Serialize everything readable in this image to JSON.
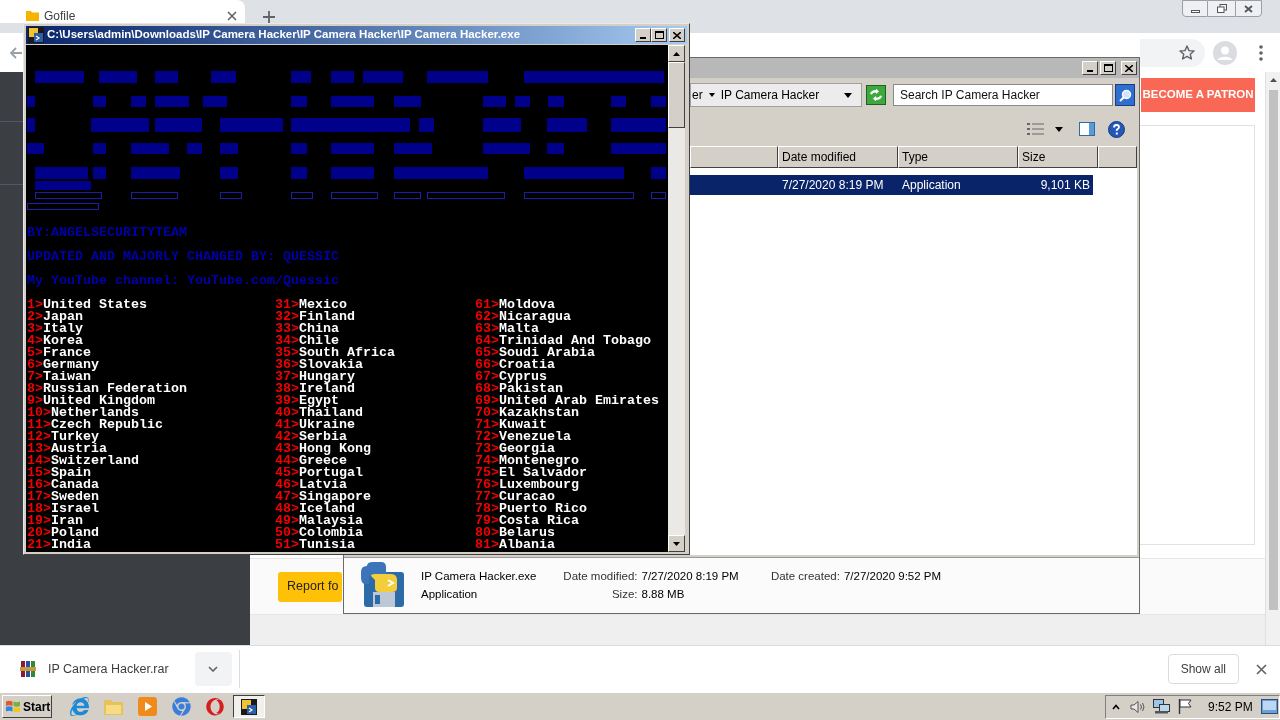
{
  "browser": {
    "tab": {
      "title": "Gofile"
    },
    "patron_button": "BECOME A PATRON",
    "report_button": "Report fo"
  },
  "download_bar": {
    "file_name": "IP Camera Hacker.rar",
    "show_all": "Show all"
  },
  "explorer": {
    "breadcrumb": [
      "er",
      "IP Camera Hacker"
    ],
    "search": {
      "placeholder": "Search IP Camera Hacker"
    },
    "columns": [
      "Date modified",
      "Type",
      "Size"
    ],
    "rows": [
      {
        "selected": true,
        "cells": [
          "7/27/2020 8:19 PM",
          "Application",
          "9,101 KB"
        ]
      }
    ],
    "details": {
      "name": "IP Camera Hacker.exe",
      "type": "Application",
      "field_groups": [
        [
          {
            "label": "Date modified:",
            "value": "7/27/2020 8:19 PM"
          },
          {
            "label": "Size:",
            "value": "8.88 MB"
          }
        ],
        [
          {
            "label": "Date created:",
            "value": "7/27/2020 9:52 PM"
          }
        ]
      ]
    }
  },
  "console": {
    "title": "C:\\Users\\admin\\Downloads\\IP Camera Hacker\\IP Camera Hacker\\IP Camera Hacker.exe",
    "lines": [
      "BY:ANGELSECURITYTEAM",
      "UPDATED AND MAJORLY CHANGED BY: QUESSIC",
      "My YouTube channel: YouTube.com/Quessic"
    ],
    "menu_columns": [
      [
        {
          "num": "1>",
          "name": "United States"
        },
        {
          "num": "2>",
          "name": "Japan"
        },
        {
          "num": "3>",
          "name": "Italy"
        },
        {
          "num": "4>",
          "name": "Korea"
        },
        {
          "num": "5>",
          "name": "France"
        },
        {
          "num": "6>",
          "name": "Germany"
        },
        {
          "num": "7>",
          "name": "Taiwan"
        },
        {
          "num": "8>",
          "name": "Russian Federation"
        },
        {
          "num": "9>",
          "name": "United Kingdom"
        },
        {
          "num": "10>",
          "name": "Netherlands"
        },
        {
          "num": "11>",
          "name": "Czech Republic"
        },
        {
          "num": "12>",
          "name": "Turkey"
        },
        {
          "num": "13>",
          "name": "Austria"
        },
        {
          "num": "14>",
          "name": "Switzerland"
        },
        {
          "num": "15>",
          "name": "Spain"
        },
        {
          "num": "16>",
          "name": "Canada"
        },
        {
          "num": "17>",
          "name": "Sweden"
        },
        {
          "num": "18>",
          "name": "Israel"
        },
        {
          "num": "19>",
          "name": "Iran"
        },
        {
          "num": "20>",
          "name": "Poland"
        },
        {
          "num": "21>",
          "name": "India"
        }
      ],
      [
        {
          "num": "31>",
          "name": "Mexico"
        },
        {
          "num": "32>",
          "name": "Finland"
        },
        {
          "num": "33>",
          "name": "China"
        },
        {
          "num": "34>",
          "name": "Chile"
        },
        {
          "num": "35>",
          "name": "South Africa"
        },
        {
          "num": "36>",
          "name": "Slovakia"
        },
        {
          "num": "37>",
          "name": "Hungary"
        },
        {
          "num": "38>",
          "name": "Ireland"
        },
        {
          "num": "39>",
          "name": "Egypt"
        },
        {
          "num": "40>",
          "name": "Thailand"
        },
        {
          "num": "41>",
          "name": "Ukraine"
        },
        {
          "num": "42>",
          "name": "Serbia"
        },
        {
          "num": "43>",
          "name": "Hong Kong"
        },
        {
          "num": "44>",
          "name": "Greece"
        },
        {
          "num": "45>",
          "name": "Portugal"
        },
        {
          "num": "46>",
          "name": "Latvia"
        },
        {
          "num": "47>",
          "name": "Singapore"
        },
        {
          "num": "48>",
          "name": "Iceland"
        },
        {
          "num": "49>",
          "name": "Malaysia"
        },
        {
          "num": "50>",
          "name": "Colombia"
        },
        {
          "num": "51>",
          "name": "Tunisia"
        }
      ],
      [
        {
          "num": "61>",
          "name": "Moldova"
        },
        {
          "num": "62>",
          "name": "Nicaragua"
        },
        {
          "num": "63>",
          "name": "Malta"
        },
        {
          "num": "64>",
          "name": "Trinidad And Tobago"
        },
        {
          "num": "65>",
          "name": "Soudi Arabia"
        },
        {
          "num": "66>",
          "name": "Croatia"
        },
        {
          "num": "67>",
          "name": "Cyprus"
        },
        {
          "num": "68>",
          "name": "Pakistan"
        },
        {
          "num": "69>",
          "name": "United Arab Emirates"
        },
        {
          "num": "70>",
          "name": "Kazakhstan"
        },
        {
          "num": "71>",
          "name": "Kuwait"
        },
        {
          "num": "72>",
          "name": "Venezuela"
        },
        {
          "num": "73>",
          "name": "Georgia"
        },
        {
          "num": "74>",
          "name": "Montenegro"
        },
        {
          "num": "75>",
          "name": "El Salvador"
        },
        {
          "num": "76>",
          "name": "Luxembourg"
        },
        {
          "num": "77>",
          "name": "Curacao"
        },
        {
          "num": "78>",
          "name": "Puerto Rico"
        },
        {
          "num": "79>",
          "name": "Costa Rica"
        },
        {
          "num": "80>",
          "name": "Belarus"
        },
        {
          "num": "81>",
          "name": "Albania"
        }
      ]
    ]
  },
  "taskbar": {
    "start": "Start",
    "console_task": {
      "active": true
    },
    "clock": "9:52 PM"
  }
}
